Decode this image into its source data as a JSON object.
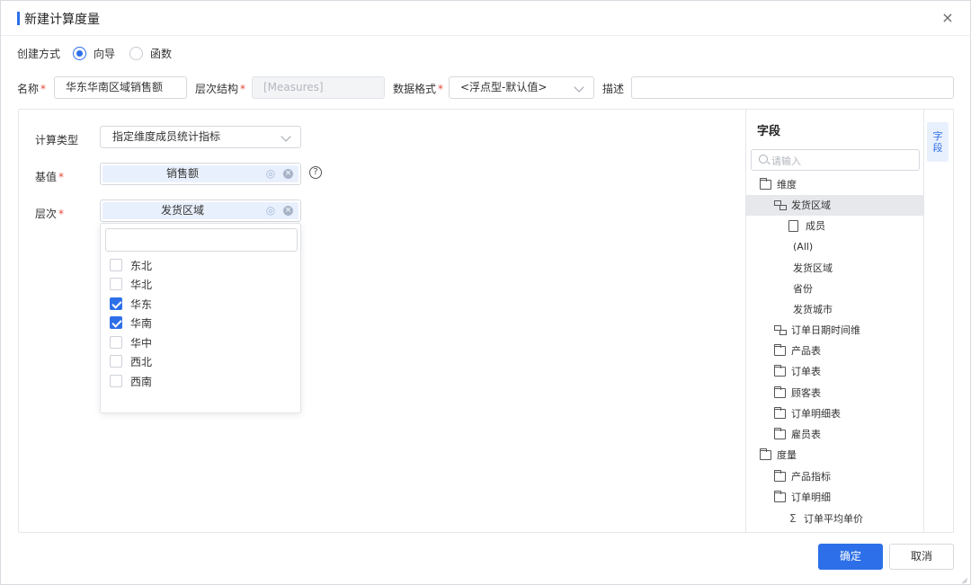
{
  "dialog": {
    "title": "新建计算度量",
    "close_glyph": "×"
  },
  "mode": {
    "label": "创建方式",
    "options": [
      {
        "label": "向导",
        "selected": true
      },
      {
        "label": "函数",
        "selected": false
      }
    ]
  },
  "fields": {
    "name_label": "名称",
    "name_value": "华东华南区域销售额",
    "hierarchy_label": "层次结构",
    "hierarchy_value": "[Measures]",
    "format_label": "数据格式",
    "format_value": "<浮点型-默认值>",
    "desc_label": "描述",
    "desc_value": "",
    "required_mark": "*"
  },
  "calc": {
    "type_label": "计算类型",
    "type_value": "指定维度成员统计指标",
    "base_label": "基值",
    "base_value": "销售额",
    "level_label": "层次",
    "level_value": "发货区域",
    "help_glyph": "?"
  },
  "dropdown": {
    "search_value": "",
    "options": [
      {
        "label": "东北",
        "checked": false
      },
      {
        "label": "华北",
        "checked": false
      },
      {
        "label": "华东",
        "checked": true
      },
      {
        "label": "华南",
        "checked": true
      },
      {
        "label": "华中",
        "checked": false
      },
      {
        "label": "西北",
        "checked": false
      },
      {
        "label": "西南",
        "checked": false
      }
    ]
  },
  "fields_panel": {
    "title": "字段",
    "search_placeholder": "请输入",
    "side_tab": "字段",
    "tree": [
      {
        "label": "维度",
        "icon": "folder-open-icon",
        "depth": 0
      },
      {
        "label": "发货区域",
        "icon": "hierarchy-icon",
        "depth": 1,
        "selected": true
      },
      {
        "label": "成员",
        "icon": "member-icon",
        "depth": 2
      },
      {
        "label": "(All)",
        "icon": "",
        "depth": 2
      },
      {
        "label": "发货区域",
        "icon": "",
        "depth": 2
      },
      {
        "label": "省份",
        "icon": "",
        "depth": 2
      },
      {
        "label": "发货城市",
        "icon": "",
        "depth": 2
      },
      {
        "label": "订单日期时间维",
        "icon": "hierarchy-icon",
        "depth": 1
      },
      {
        "label": "产品表",
        "icon": "folder-icon",
        "depth": 1
      },
      {
        "label": "订单表",
        "icon": "folder-icon",
        "depth": 1
      },
      {
        "label": "顾客表",
        "icon": "folder-icon",
        "depth": 1
      },
      {
        "label": "订单明细表",
        "icon": "folder-icon",
        "depth": 1
      },
      {
        "label": "雇员表",
        "icon": "folder-icon",
        "depth": 1
      },
      {
        "label": "度量",
        "icon": "folder-open-icon",
        "depth": 0
      },
      {
        "label": "产品指标",
        "icon": "folder-icon",
        "depth": 1
      },
      {
        "label": "订单明细",
        "icon": "folder-open-icon",
        "depth": 1
      },
      {
        "label": "订单平均单价",
        "icon": "sigma-icon",
        "depth": 2
      }
    ]
  },
  "footer": {
    "ok_label": "确定",
    "cancel_label": "取消"
  },
  "colors": {
    "accent": "#2d6fe8",
    "token_bg": "#e9f0fd",
    "selected_row": "#e6e8ec"
  }
}
